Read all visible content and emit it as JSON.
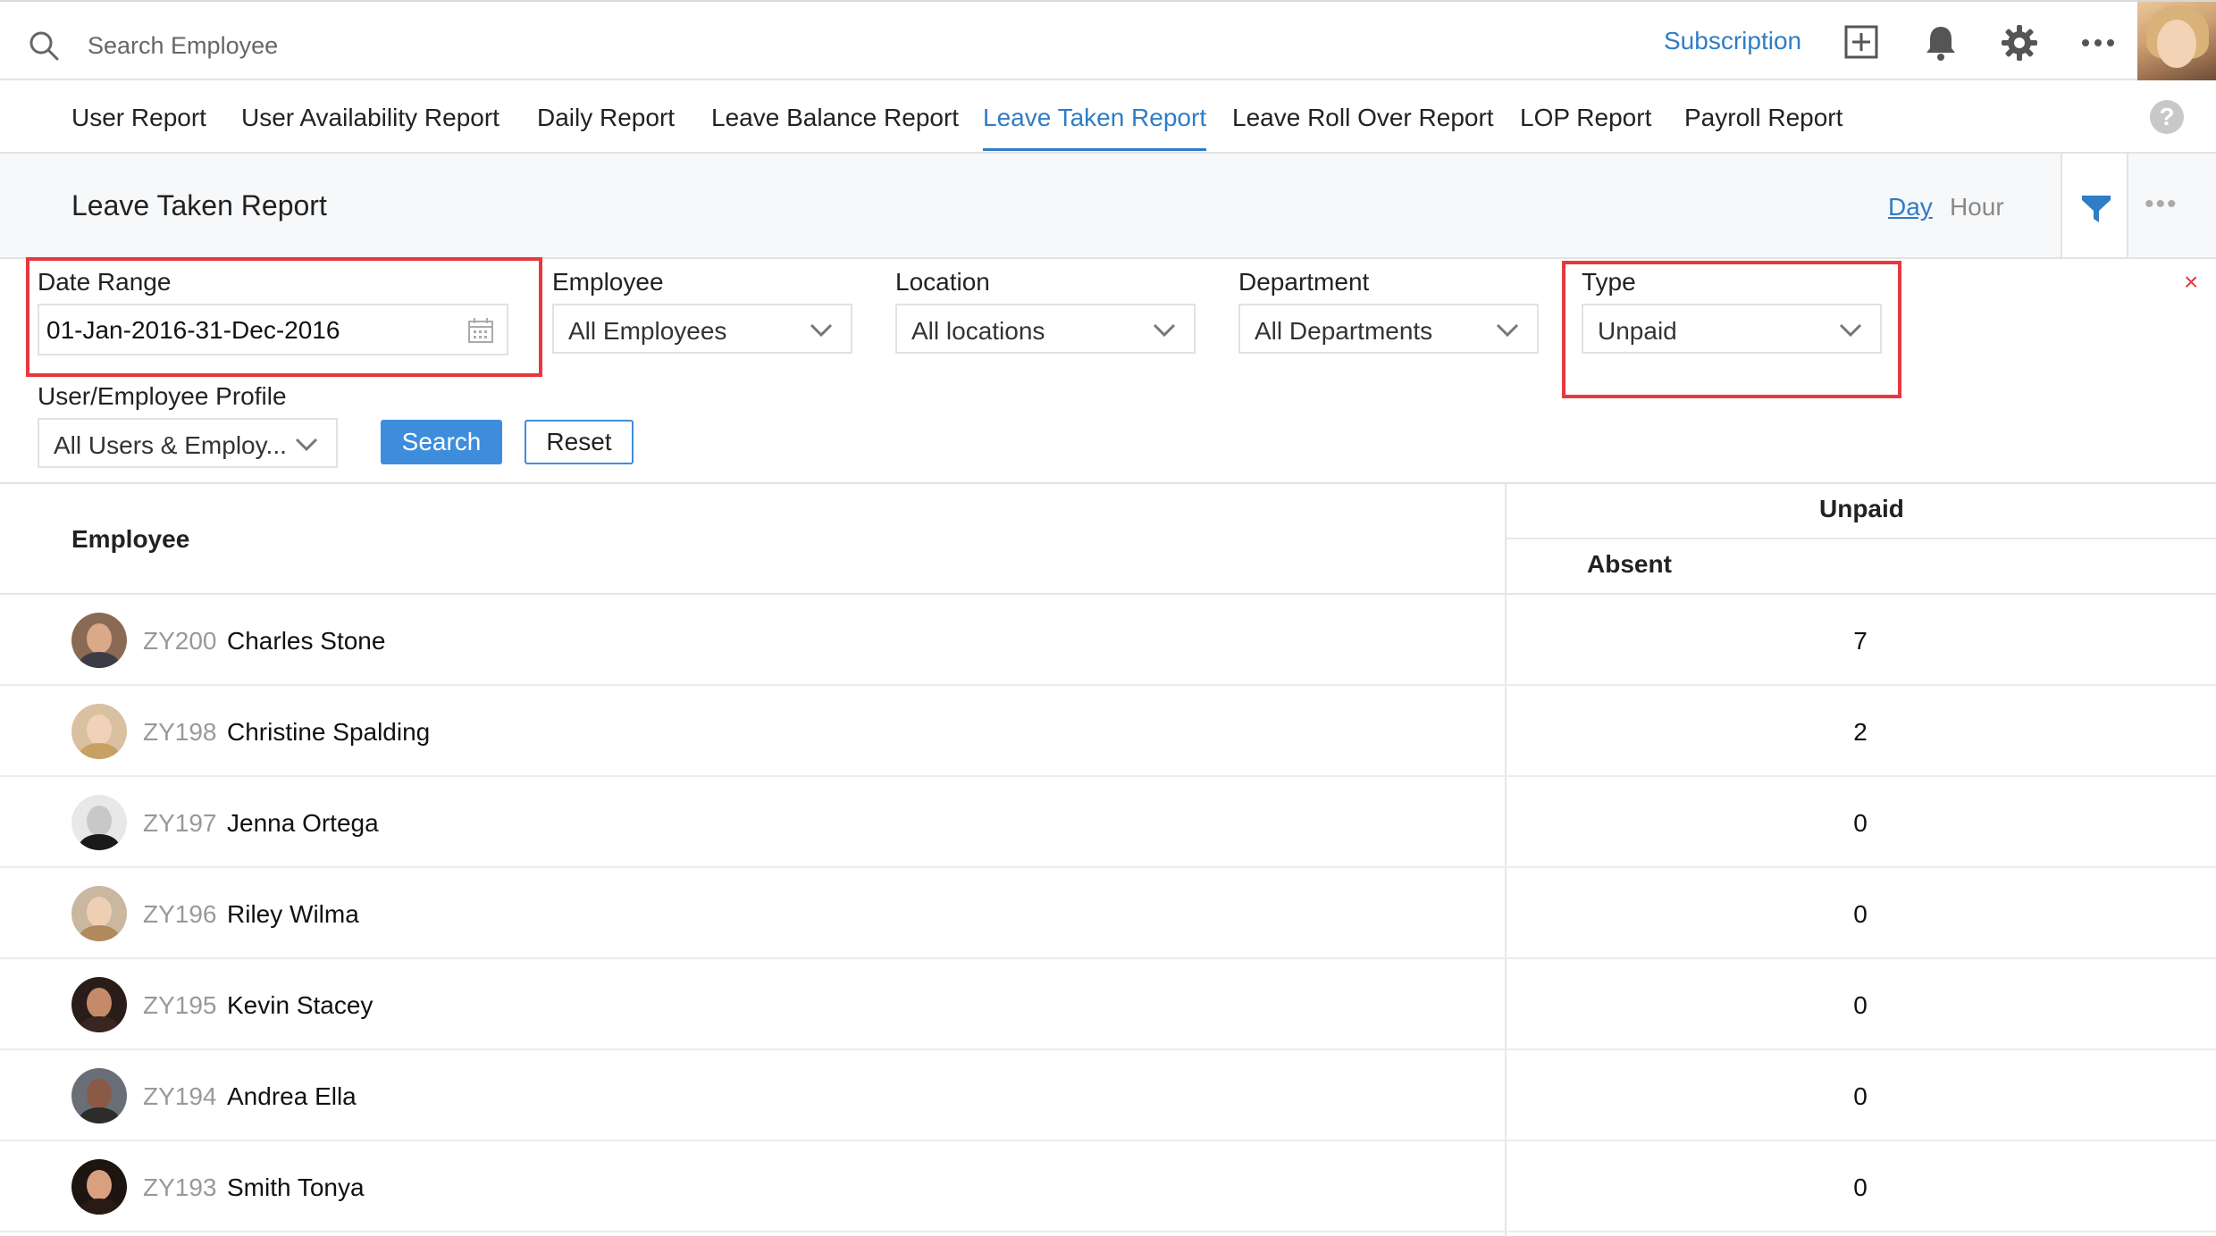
{
  "topbar": {
    "search_placeholder": "Search Employee",
    "subscription_label": "Subscription",
    "icons": [
      "search-icon",
      "add-icon",
      "bell-icon",
      "gear-icon",
      "more-icon",
      "user-avatar"
    ]
  },
  "tabs": [
    {
      "label": "User Report",
      "active": false
    },
    {
      "label": "User Availability Report",
      "active": false
    },
    {
      "label": "Daily Report",
      "active": false
    },
    {
      "label": "Leave Balance Report",
      "active": false
    },
    {
      "label": "Leave Taken Report",
      "active": true
    },
    {
      "label": "Leave Roll Over Report",
      "active": false
    },
    {
      "label": "LOP Report",
      "active": false
    },
    {
      "label": "Payroll Report",
      "active": false
    }
  ],
  "help_label": "?",
  "page": {
    "title": "Leave Taken Report",
    "unit_toggle": {
      "day": "Day",
      "hour": "Hour",
      "selected": "Day"
    },
    "more_label": "•••"
  },
  "filters": {
    "date_range": {
      "label": "Date Range",
      "value": "01-Jan-2016-31-Dec-2016"
    },
    "employee": {
      "label": "Employee",
      "value": "All Employees"
    },
    "location": {
      "label": "Location",
      "value": "All locations"
    },
    "department": {
      "label": "Department",
      "value": "All Departments"
    },
    "type": {
      "label": "Type",
      "value": "Unpaid"
    },
    "profile": {
      "label": "User/Employee Profile",
      "value": "All Users & Employ..."
    },
    "search_label": "Search",
    "reset_label": "Reset",
    "close_label": "×"
  },
  "table": {
    "employee_header": "Employee",
    "group_header": "Unpaid",
    "sub_header": "Absent",
    "rows": [
      {
        "id": "ZY200",
        "name": "Charles Stone",
        "absent": "7"
      },
      {
        "id": "ZY198",
        "name": "Christine Spalding",
        "absent": "2"
      },
      {
        "id": "ZY197",
        "name": "Jenna Ortega",
        "absent": "0"
      },
      {
        "id": "ZY196",
        "name": "Riley Wilma",
        "absent": "0"
      },
      {
        "id": "ZY195",
        "name": "Kevin Stacey",
        "absent": "0"
      },
      {
        "id": "ZY194",
        "name": "Andrea Ella",
        "absent": "0"
      },
      {
        "id": "ZY193",
        "name": "Smith Tonya",
        "absent": "0"
      }
    ]
  },
  "colors": {
    "accent": "#2e7dc6",
    "button": "#3e8ddd",
    "highlight": "#e8373e",
    "muted_id": "#999999"
  }
}
